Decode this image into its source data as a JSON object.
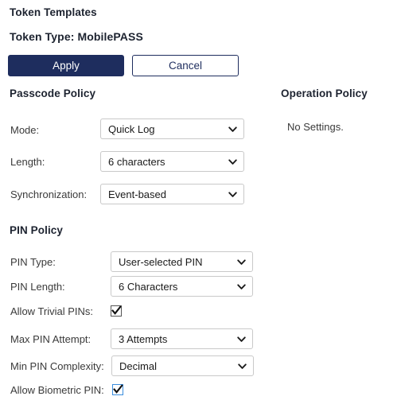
{
  "page": {
    "title": "Token Templates",
    "token_type_line": "Token Type: MobilePASS"
  },
  "actions": {
    "apply_label": "Apply",
    "cancel_label": "Cancel"
  },
  "colors": {
    "primary": "#1e2d5e",
    "select_border": "#c9c9c9",
    "checkbox_focus": "#3a8ddd",
    "text": "#2b2b2b"
  },
  "passcode_policy": {
    "heading": "Passcode Policy",
    "fields": [
      {
        "label": "Mode:",
        "value": "Quick Log"
      },
      {
        "label": "Length:",
        "value": "6 characters"
      },
      {
        "label": "Synchronization:",
        "value": "Event-based"
      }
    ]
  },
  "operation_policy": {
    "heading": "Operation Policy",
    "empty_text": "No Settings."
  },
  "pin_policy": {
    "heading": "PIN Policy",
    "fields": [
      {
        "label": "PIN Type:",
        "value": "User-selected PIN"
      },
      {
        "label": "PIN Length:",
        "value": "6 Characters"
      },
      {
        "label": "Allow Trivial PINs:",
        "value": "checked"
      },
      {
        "label": "Max PIN Attempt:",
        "value": "3 Attempts"
      },
      {
        "label": "Min PIN Complexity:",
        "value": "Decimal"
      },
      {
        "label": "Allow Biometric PIN:",
        "value": "checked"
      }
    ]
  },
  "icons": {
    "chevron": "chevron-down-icon",
    "check": "check-mark-icon"
  }
}
